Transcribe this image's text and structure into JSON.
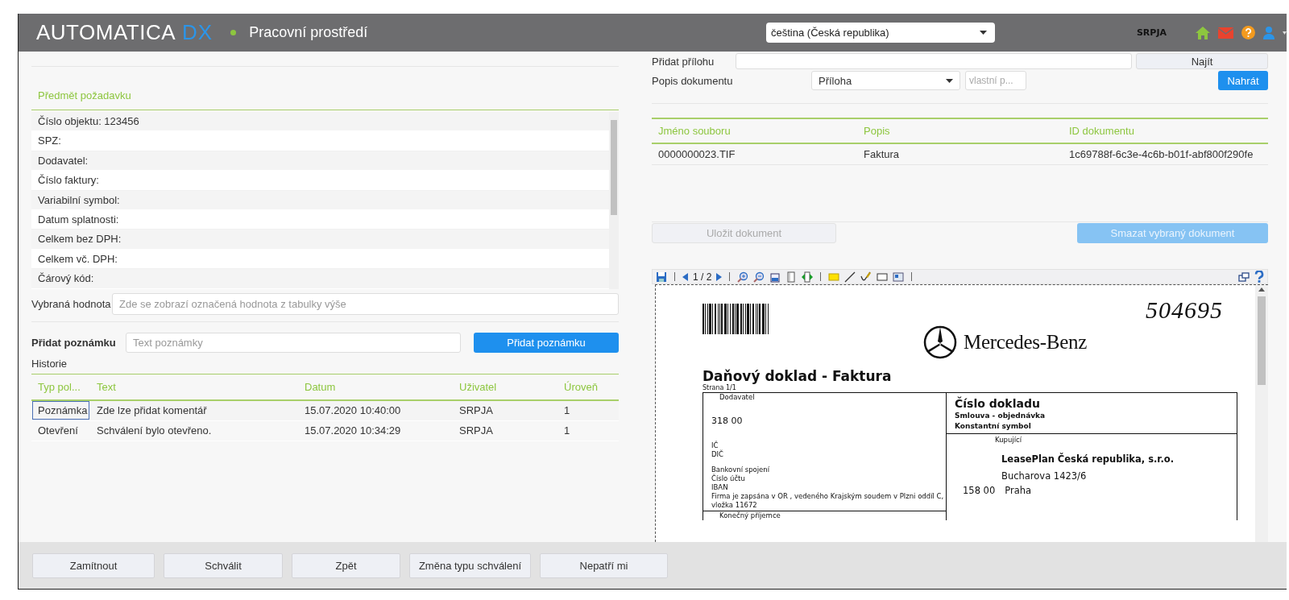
{
  "header": {
    "logo": "AUTOMATICA",
    "logo_accent": "DX",
    "title": "Pracovní prostředí",
    "language": "čeština (Česká republika)",
    "user": "SRPJA"
  },
  "request": {
    "heading": "Předmět požadavku",
    "fields": [
      "Číslo objektu: 123456",
      "SPZ:",
      "Dodavatel:",
      "Číslo faktury:",
      "Variabilní symbol:",
      "Datum splatnosti:",
      "Celkem bez DPH:",
      "Celkem vč. DPH:",
      "Čárový kód:"
    ]
  },
  "selected_value": {
    "label": "Vybraná hodnota",
    "placeholder": "Zde se zobrazí označená hodnota z tabulky výše"
  },
  "note": {
    "label": "Přidat poznámku",
    "placeholder": "Text poznámky",
    "button": "Přidat poznámku"
  },
  "history": {
    "title": "Historie",
    "columns": [
      "Typ pol...",
      "Text",
      "Datum",
      "Uživatel",
      "Úroveň"
    ],
    "rows": [
      {
        "cells": [
          "Poznámka",
          "Zde lze přidat komentář",
          "15.07.2020 10:40:00",
          "SRPJA",
          "1"
        ],
        "selected": true
      },
      {
        "cells": [
          "Otevření",
          "Schválení bylo otevřeno.",
          "15.07.2020 10:34:29",
          "SRPJA",
          "1"
        ],
        "selected": false
      }
    ]
  },
  "attachment": {
    "label": "Přidat přílohu",
    "button": "Najít"
  },
  "description": {
    "label": "Popis dokumentu",
    "value": "Příloha",
    "placeholder": "vlastní p...",
    "button": "Nahrát"
  },
  "documents": {
    "columns": [
      "Jméno souboru",
      "Popis",
      "ID dokumentu"
    ],
    "rows": [
      {
        "cells": [
          "0000000023.TIF",
          "Faktura",
          "1c69788f-6c3e-4c6b-b01f-abf800f290fe"
        ]
      }
    ]
  },
  "document_actions": [
    {
      "label": "Uložit dokument",
      "kind": "secondary",
      "disabled": true
    },
    {
      "label": "Smazat vybraný dokument",
      "kind": "primary",
      "disabled": true
    }
  ],
  "viewer": {
    "page": "1 / 2"
  },
  "invoice": {
    "handwritten": "504695",
    "brand": "Mercedes-Benz",
    "title": "Daňový doklad - Faktura",
    "page": "Strana 1/1",
    "supplier": {
      "heading": "Dodavatel",
      "zip": "318 00",
      "ids": [
        "IČ",
        "DIČ"
      ],
      "bank": [
        "Bankovní spojení",
        "Číslo účtu",
        "IBAN"
      ],
      "registry": "Firma je zapsána v OR , vedeného Krajským soudem v Plzni oddíl C, vložka 11672"
    },
    "document_number": {
      "label": "Číslo dokladu",
      "lines": [
        "Smlouva - objednávka",
        "Konstantní symbol"
      ]
    },
    "buyer": {
      "heading": "Kupující",
      "name": "LeasePlan Česká republika, s.r.o.",
      "street": "Bucharova 1423/6",
      "zip": "158 00",
      "city": "Praha"
    },
    "recipient": "Konečný příjemce"
  },
  "footer_buttons": [
    "Zamítnout",
    "Schválit",
    "Zpět",
    "Změna typu schválení",
    "Nepatří mi"
  ]
}
